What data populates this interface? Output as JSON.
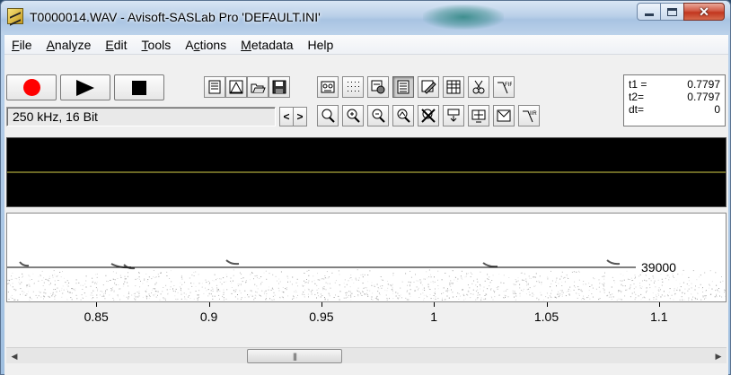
{
  "window": {
    "title": "T0000014.WAV - Avisoft-SASLab Pro  'DEFAULT.INI'",
    "caption_buttons": {
      "minimize": "minimize",
      "maximize": "maximize",
      "close": "close"
    }
  },
  "menu": [
    {
      "key": "file",
      "label": "File",
      "mnemonic": "F"
    },
    {
      "key": "analyze",
      "label": "Analyze",
      "mnemonic": "A"
    },
    {
      "key": "edit",
      "label": "Edit",
      "mnemonic": "E"
    },
    {
      "key": "tools",
      "label": "Tools",
      "mnemonic": "T"
    },
    {
      "key": "actions",
      "label": "Actions",
      "mnemonic": "c"
    },
    {
      "key": "metadata",
      "label": "Metadata",
      "mnemonic": "M"
    },
    {
      "key": "help",
      "label": "Help",
      "mnemonic": ""
    }
  ],
  "transport": {
    "record": {
      "icon": "record-icon",
      "color": "#ff0000"
    },
    "play": {
      "icon": "play-icon"
    },
    "stop": {
      "icon": "stop-icon"
    }
  },
  "toolbar_row1": [
    "notes-icon",
    "envelope-icon",
    "open-folder-icon",
    "save-icon",
    "cassette-icon",
    "dotted-grid-icon",
    "spectrogram-options-icon",
    "list-icon",
    "draw-icon",
    "grid-table-icon",
    "cut-icon",
    "fir-filter-icon"
  ],
  "toolbar_row1_pressed": "list-icon",
  "toolbar_row2": [
    "zoom-icon",
    "zoom-in-icon",
    "zoom-out-icon",
    "zoom-time-icon",
    "zoom-reset-icon",
    "expand-icon",
    "display-icon",
    "envelope-view-icon",
    "iir-filter-icon"
  ],
  "status": {
    "format": "250 kHz, 16 Bit",
    "nav_prev": "<",
    "nav_next": ">"
  },
  "cursor": {
    "t1_label": "t1 =",
    "t1_value": "0.7797",
    "t2_label": "t2=",
    "t2_value": "0.7797",
    "dt_label": "dt=",
    "dt_value": "0"
  },
  "spectrogram": {
    "marker_label": "39000"
  },
  "time_axis": {
    "min": 0.81,
    "max": 1.13,
    "ticks": [
      "0.85",
      "0.9",
      "0.95",
      "1",
      "1.05",
      "1.1"
    ],
    "tick_values": [
      0.85,
      0.9,
      0.95,
      1.0,
      1.05,
      1.1
    ]
  },
  "scrollbar": {
    "left": "◀",
    "right": "▶",
    "thumb_grip": "|||"
  },
  "colors": {
    "oscillogram_bg": "#000000",
    "waveform": "#d8d24a",
    "spectrogram_bg": "#ffffff"
  }
}
